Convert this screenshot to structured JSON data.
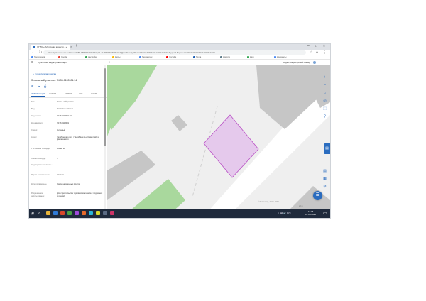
{
  "browser": {
    "tab_title": "ФГИС «Публичная кадастр…»",
    "tab_close": "×",
    "new_tab": "+",
    "url": "https://pkk.rosreestr.ru/#/search/55.16589447367723,61.41068265180394/17/@5w3tuw6yz?text=74%3A36%3A0112001%3A94&type=1&opened=74%3A36%3A0112001%3A94",
    "bookmarks": [
      {
        "label": "Приложения",
        "color": "#4a8af4"
      },
      {
        "label": "Google",
        "color": "#ea4335"
      },
      {
        "label": "Настройки",
        "color": "#34a853"
      },
      {
        "label": "Карты",
        "color": "#fbbc05"
      },
      {
        "label": "Переводчик",
        "color": "#4a8af4"
      },
      {
        "label": "YouTube",
        "color": "#ff0000"
      },
      {
        "label": "Почта",
        "color": "#1d5fb4"
      },
      {
        "label": "Новости",
        "color": "#607d8b"
      },
      {
        "label": "Диск",
        "color": "#34a853"
      },
      {
        "label": "Документы",
        "color": "#4a8af4"
      }
    ],
    "win_minimize": "–",
    "win_maximize": "□",
    "win_close": "×"
  },
  "app": {
    "menu_icon": "≡",
    "name": "Публичная кадастровая карта",
    "collapse_icon": "‹",
    "search_placeholder": "Адрес, кадастровый номер",
    "more_icon": "⋮"
  },
  "panel": {
    "back_label": "‹ К результатам поиска",
    "title": "Земельный участок : 74:36:0112001:94",
    "icons": [
      "⇱",
      "⇆",
      "⎙"
    ],
    "tabs": [
      {
        "label": "ИНФОРМАЦИЯ",
        "active": true
      },
      {
        "label": "УСЛУГИ",
        "active": false
      },
      {
        "label": "ЗАЯВКИ",
        "active": false
      },
      {
        "label": "ОКС",
        "active": false
      },
      {
        "label": "ЗОУИТ",
        "active": false
      }
    ],
    "rows": [
      {
        "key": "Тип:",
        "value": "Земельный участок"
      },
      {
        "key": "Вид:",
        "value": "Землепользование"
      },
      {
        "key": "Кад. номер:",
        "value": "74:36:0112001:94"
      },
      {
        "key": "Кад. квартал:",
        "value": "74:36:0112001"
      },
      {
        "key": "Статус:",
        "value": "Учтенный"
      },
      {
        "key": "Адрес:",
        "value": "Челябинская обл., г Челябинск, р-н Советский, ул Дзержинского"
      },
      {
        "key": "Уточненная площадь:",
        "value": "980 кв. м"
      },
      {
        "key": "Общая площадь:",
        "value": "–"
      },
      {
        "key": "Кадастровая стоимость:",
        "value": "–"
      },
      {
        "key": "Форма собственности:",
        "value": "Частная"
      },
      {
        "key": "Категория земель:",
        "value": "Земли населенных пунктов"
      },
      {
        "key": "Разрешенное использование:",
        "value": "Для строительства торгового комплекса с подземной стоянкой"
      }
    ]
  },
  "map": {
    "copyright": "© Росреестр, 2010–2020",
    "scale_label": "20 м",
    "fab_icon": "☰",
    "side_tab_icon": "▤",
    "tools": [
      "+",
      "–",
      "⌂",
      "◎",
      "⬚",
      "⚲"
    ],
    "bottom_tools": [
      "▤",
      "▦",
      "⚙"
    ]
  },
  "taskbar": {
    "start_icon": "⊞",
    "search_icon": "⌕",
    "apps": [
      "#e8b53a",
      "#2f7bd9",
      "#d9472b",
      "#47a344",
      "#9e4ad9",
      "#e66a2c",
      "#2bb5d9",
      "#d9d92b",
      "#5b6b84",
      "#cc3366"
    ],
    "tray": "∧ ⌨ 🔊 РУС",
    "time": "12:45",
    "date": "07.06.2020",
    "notif_icon": "▭"
  },
  "colors": {
    "accent": "#2a6cbf",
    "parcel_fill": "#e5c9ec",
    "parcel_stroke": "#b84fc5",
    "green": "#a9d89d",
    "building": "#c6c6c6"
  }
}
